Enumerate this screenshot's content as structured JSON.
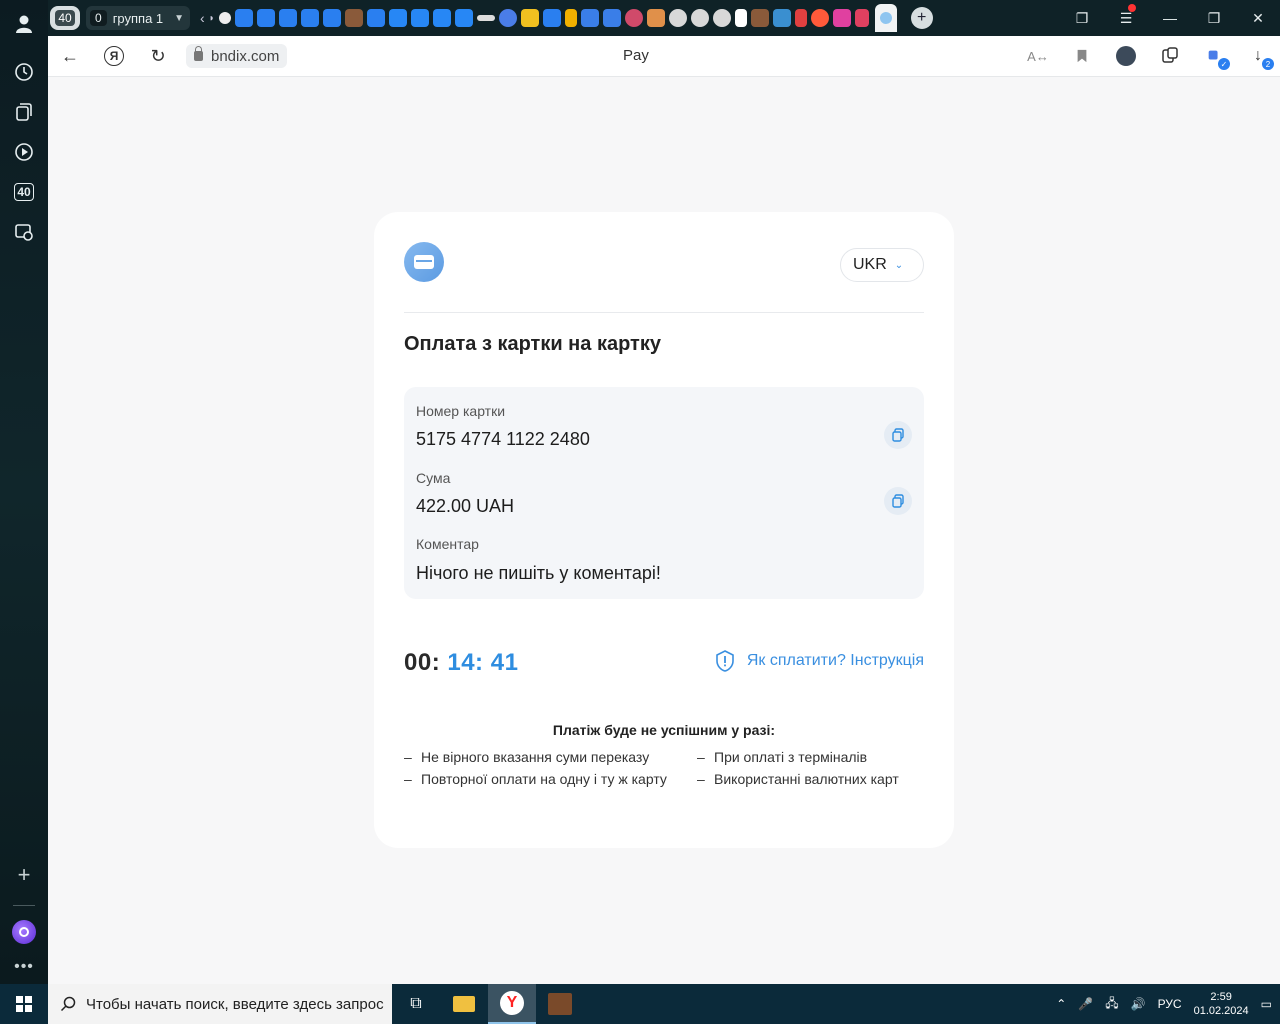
{
  "browser": {
    "tab_count": "40",
    "group_count": "0",
    "group_name": "группа 1",
    "sidebar_counter": "40",
    "url": "bndix.com",
    "page_title": "Pay",
    "downloads_badge": "2",
    "colors": {
      "tabbar": "#0f2227",
      "sidebar": "#0c1b21"
    }
  },
  "card": {
    "language": "UKR",
    "title": "Оплата з картки на картку",
    "fields": [
      {
        "label": "Номер картки",
        "value": "5175 4774 1122 2480",
        "copy": true
      },
      {
        "label": "Сума",
        "value": "422.00 UAH",
        "copy": true
      },
      {
        "label": "Коментар",
        "value": "Нічого не пишіть у коментарі!",
        "copy": false
      }
    ],
    "timer": {
      "hours": "00:",
      "minutes": "14:",
      "seconds": "41"
    },
    "howto_link": "Як сплатити? Інструкція",
    "failure_title": "Платіж буде не успішним у разі:",
    "failure_left": [
      "Не вірного вказання суми переказу",
      "Повторної оплати на одну і ту ж карту"
    ],
    "failure_right": [
      "При оплаті з терміналів",
      "Використанні валютних карт"
    ],
    "colors": {
      "accent": "#2e8de0",
      "info_bg": "#f4f6f9"
    }
  },
  "taskbar": {
    "search_placeholder": "Чтобы начать поиск, введите здесь запрос",
    "language": "РУС",
    "time": "2:59",
    "date": "01.02.2024"
  }
}
